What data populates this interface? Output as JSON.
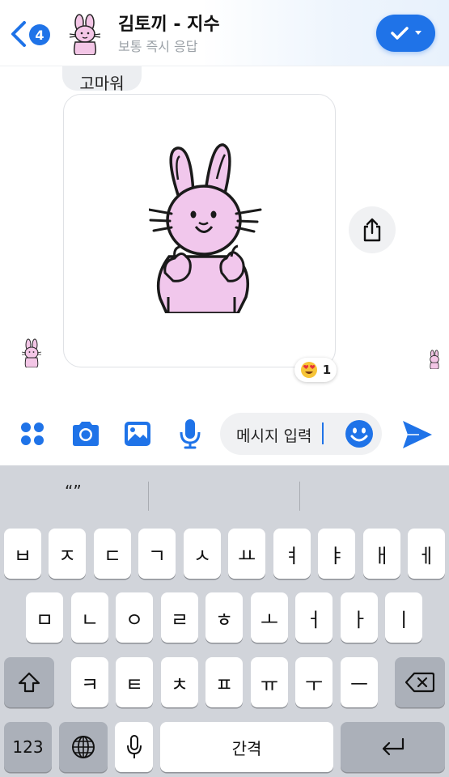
{
  "header": {
    "back_count": "4",
    "title": "김토끼 - 지수",
    "subtitle": "보통 즉시 응답",
    "status_icon": "check-icon",
    "accent": "#1f73e8"
  },
  "messages": {
    "previous_text": "고마워",
    "sticker_name": "pink-bunny-thumbs-up-sticker",
    "reaction": {
      "emoji": "heart-eyes-emoji",
      "count": "1"
    }
  },
  "composer": {
    "input_value": "메시지 입력",
    "icons": [
      "apps-icon",
      "camera-icon",
      "image-icon",
      "microphone-icon",
      "emoji-icon",
      "send-icon"
    ]
  },
  "keyboard": {
    "suggestions": [
      "“”",
      "",
      ""
    ],
    "row1": [
      "ㅂ",
      "ㅈ",
      "ㄷ",
      "ㄱ",
      "ㅅ",
      "ㅛ",
      "ㅕ",
      "ㅑ",
      "ㅐ",
      "ㅔ"
    ],
    "row2": [
      "ㅁ",
      "ㄴ",
      "ㅇ",
      "ㄹ",
      "ㅎ",
      "ㅗ",
      "ㅓ",
      "ㅏ",
      "ㅣ"
    ],
    "row3": [
      "ㅋ",
      "ㅌ",
      "ㅊ",
      "ㅍ",
      "ㅠ",
      "ㅜ",
      "ㅡ"
    ],
    "numbers_label": "123",
    "space_label": "간격"
  }
}
